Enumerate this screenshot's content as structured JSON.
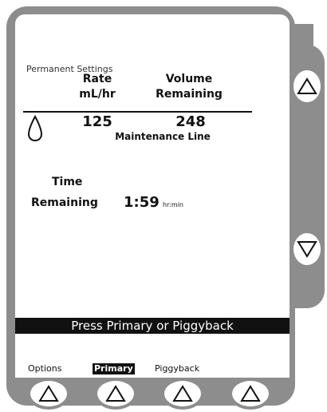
{
  "display": {
    "section_title": "Permanent Settings",
    "rate_header_1": "Rate",
    "rate_header_2": "mL/hr",
    "volume_header_1": "Volume",
    "volume_header_2": "Remaining",
    "rate_value": "125",
    "volume_value": "248",
    "line_label": "Maintenance Line",
    "time_label_1": "Time",
    "time_label_2": "Remaining",
    "time_value": "1:59",
    "time_unit": "hr:min",
    "prompt": "Press Primary or Piggyback"
  },
  "softkeys": {
    "options": "Options",
    "primary": "Primary",
    "piggyback": "Piggyback"
  },
  "icons": {
    "drop": "drop-icon",
    "up": "up-arrow-icon",
    "down": "down-arrow-icon"
  },
  "colors": {
    "bezel": "#8d8d8d",
    "screen": "#ffffff",
    "highlight": "#111111"
  }
}
